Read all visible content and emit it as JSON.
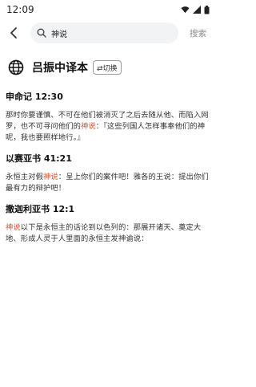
{
  "status_bar": {
    "time": "12:09"
  },
  "search": {
    "query": "神说",
    "action_label": "搜索"
  },
  "version": {
    "title": "吕振中译本",
    "switch_label": "⇄切换"
  },
  "results": [
    {
      "reference": "申命记 12:30",
      "segments": [
        {
          "text": "那时你要谨慎、不可在他们被消灭了之后去随从他、而陷入网罗，也不可寻问他们的",
          "hl": false
        },
        {
          "text": "神说",
          "hl": true
        },
        {
          "text": "：『这些列国人怎样事奉他们的神呢，我也要照样地行。』",
          "hl": false
        }
      ]
    },
    {
      "reference": "以赛亚书 41:21",
      "segments": [
        {
          "text": "永恒主对假",
          "hl": false
        },
        {
          "text": "神说",
          "hl": true
        },
        {
          "text": "：呈上你们的案件吧！雅各的王说：提出你们最有力的辩护吧！",
          "hl": false
        }
      ]
    },
    {
      "reference": "撒迦利亚书 12:1",
      "segments": [
        {
          "text": "神说",
          "hl": true
        },
        {
          "text": "以下是永恒主的话论到以色列的：那展开诸天、奠定大地、形成人灵于人里面的永恒主发神谕说：",
          "hl": false
        }
      ]
    }
  ],
  "colors": {
    "highlight": "#d9532c"
  }
}
